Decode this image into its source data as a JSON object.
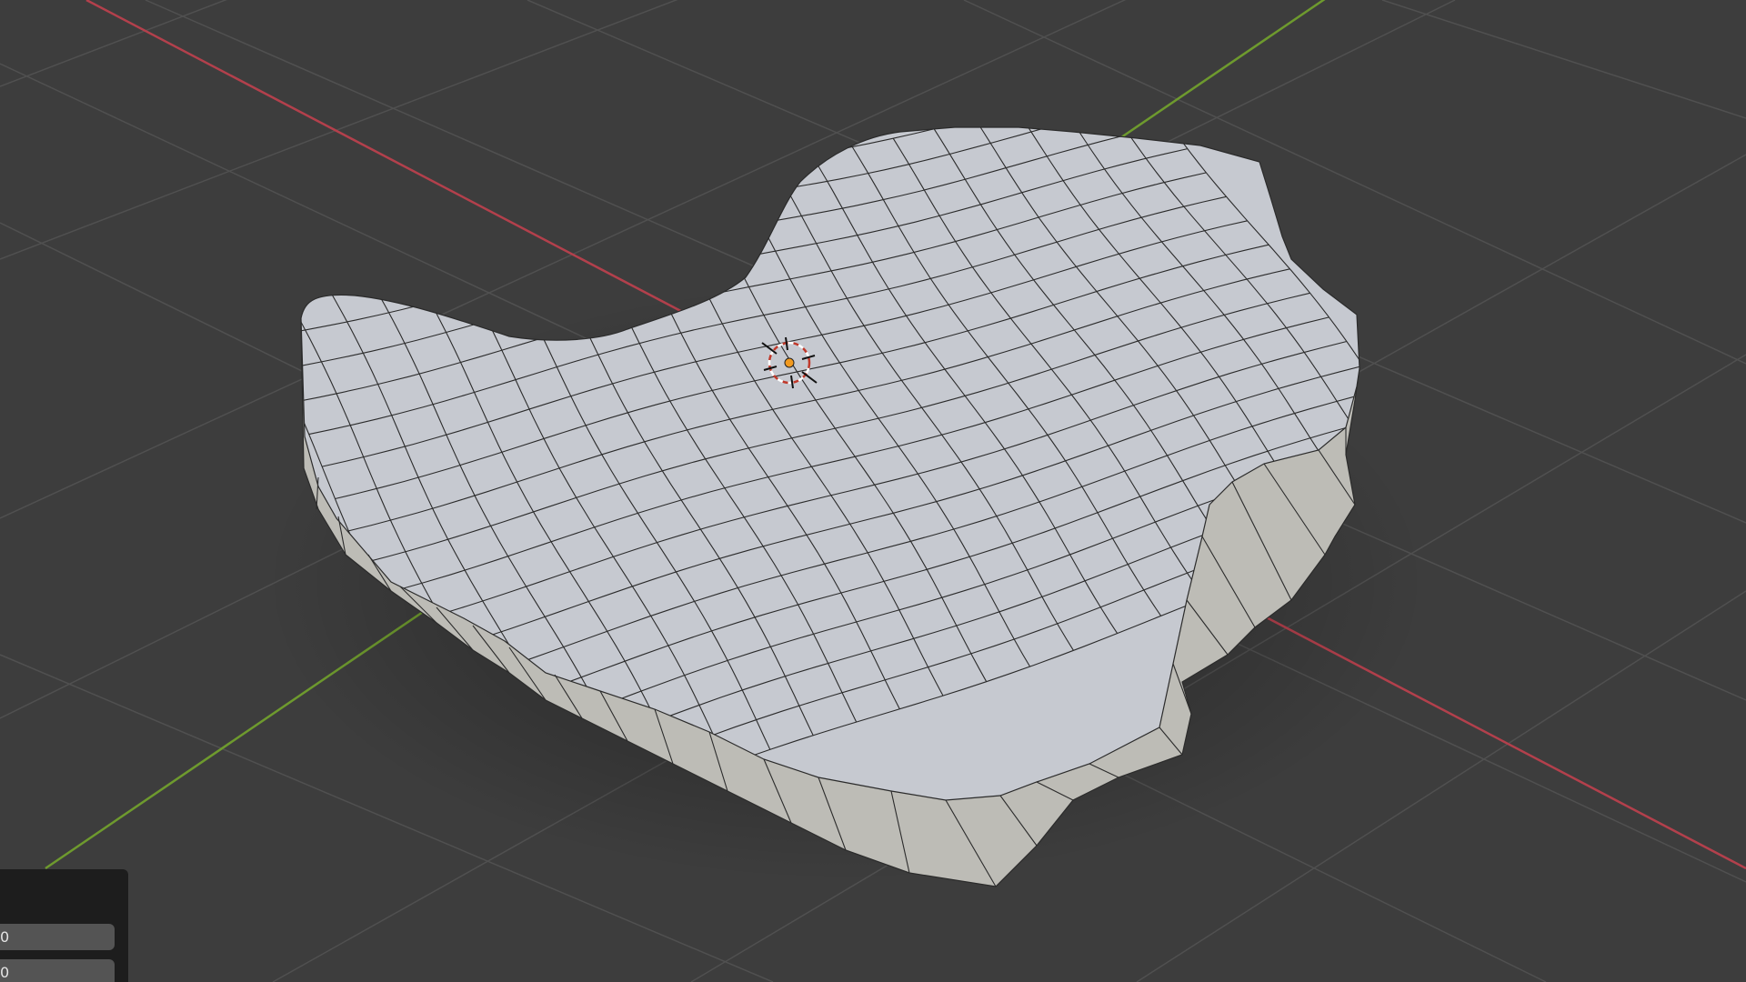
{
  "app": "3D Viewport",
  "colors": {
    "background": "#3d3d3d",
    "grid": "#505050",
    "axis_x": "#b3404c",
    "axis_y": "#6e9a2e",
    "mesh_top": "#c6c9d0",
    "mesh_side": "#bdbcb6",
    "wire": "#2b2b2b",
    "panel": "#1d1d1d",
    "field": "#545454",
    "cursor_ring": "#c0392b",
    "origin": "#f29a1f"
  },
  "icons": {
    "cursor": "3d-cursor-icon",
    "origin": "object-origin-icon"
  },
  "operator_panel": {
    "fields": [
      {
        "value": "0"
      },
      {
        "value": "0"
      }
    ]
  }
}
